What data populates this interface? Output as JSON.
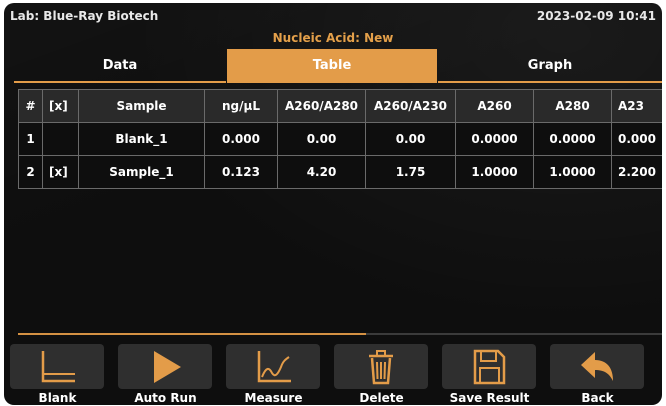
{
  "status": {
    "lab": "Lab: Blue-Ray Biotech",
    "datetime": "2023-02-09 10:41"
  },
  "subtitle": "Nucleic Acid: New",
  "tabs": [
    {
      "label": "Data",
      "active": false
    },
    {
      "label": "Table",
      "active": true
    },
    {
      "label": "Graph",
      "active": false
    }
  ],
  "table": {
    "headers": [
      "#",
      "[x]",
      "Sample",
      "ng/µL",
      "A260/A280",
      "A260/A230",
      "A260",
      "A280",
      "A23"
    ],
    "rows": [
      [
        "1",
        "",
        "Blank_1",
        "0.000",
        "0.00",
        "0.00",
        "0.0000",
        "0.0000",
        "0.000"
      ],
      [
        "2",
        "[x]",
        "Sample_1",
        "0.123",
        "4.20",
        "1.75",
        "1.0000",
        "1.0000",
        "2.200"
      ]
    ]
  },
  "scroll": {
    "position_fraction": 0.54
  },
  "toolbar": [
    {
      "label": "Blank",
      "icon": "axes-icon"
    },
    {
      "label": "Auto Run",
      "icon": "play-icon"
    },
    {
      "label": "Measure",
      "icon": "line-graph-icon"
    },
    {
      "label": "Delete",
      "icon": "trash-icon"
    },
    {
      "label": "Save Result",
      "icon": "save-icon"
    },
    {
      "label": "Back",
      "icon": "back-arrow-icon"
    }
  ],
  "colors": {
    "accent": "#e39c49",
    "background": "#0e0e0e",
    "button": "#2f2f2f"
  }
}
